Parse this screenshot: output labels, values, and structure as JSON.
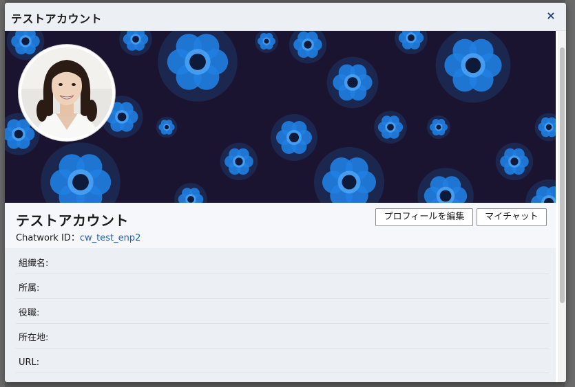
{
  "modal": {
    "title": "テストアカウント",
    "close_symbol": "×"
  },
  "profile": {
    "name": "テストアカウント",
    "id_label": "Chatwork ID：",
    "id_value": "cw_test_enp2",
    "edit_button": "プロフィールを編集",
    "mychat_button": "マイチャット"
  },
  "fields": [
    {
      "label": "組織名:"
    },
    {
      "label": "所属:"
    },
    {
      "label": "役職:"
    },
    {
      "label": "所在地:"
    },
    {
      "label": "URL:"
    }
  ],
  "colors": {
    "cover_background": "#1b1430",
    "flower_blue": "#1f7fe0",
    "link_blue": "#1f5fbf"
  }
}
